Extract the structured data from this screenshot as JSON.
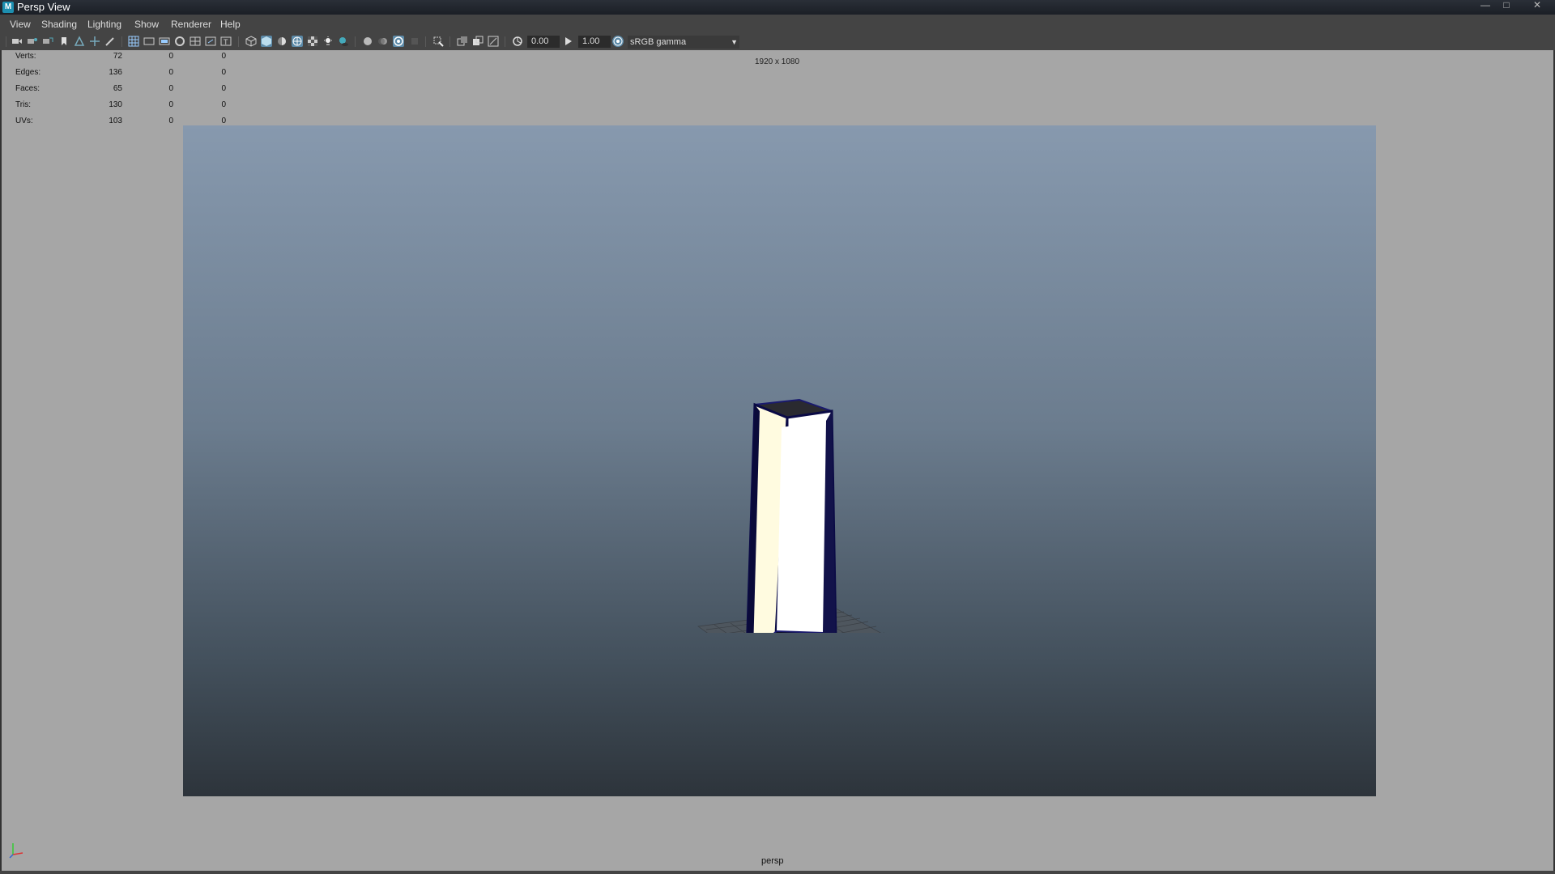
{
  "window": {
    "title": "Persp View",
    "logo_letter": "M"
  },
  "menubar": {
    "items": [
      "View",
      "Shading",
      "Lighting",
      "Show",
      "Renderer",
      "Help"
    ]
  },
  "toolbar": {
    "exposure_value": "0.00",
    "gamma_value": "1.00",
    "color_space": "sRGB gamma",
    "accent_color": "#5c8aa8"
  },
  "hud": {
    "rows": [
      {
        "label": "Verts:",
        "v1": "72",
        "v2": "0",
        "v3": "0"
      },
      {
        "label": "Edges:",
        "v1": "136",
        "v2": "0",
        "v3": "0"
      },
      {
        "label": "Faces:",
        "v1": "65",
        "v2": "0",
        "v3": "0"
      },
      {
        "label": "Tris:",
        "v1": "130",
        "v2": "0",
        "v3": "0"
      },
      {
        "label": "UVs:",
        "v1": "103",
        "v2": "0",
        "v3": "0"
      }
    ]
  },
  "viewport": {
    "resolution": "1920 x 1080",
    "camera": "persp",
    "background_top": "#8799ae",
    "background_bottom": "#2d343b"
  }
}
